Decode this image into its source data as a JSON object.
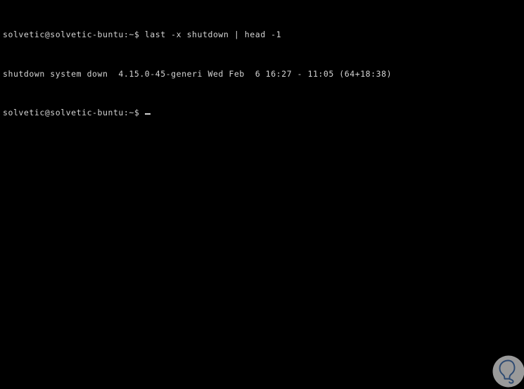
{
  "terminal": {
    "background_color": "#000000",
    "text_color": "#d4d4d4",
    "lines": [
      {
        "kind": "command",
        "prompt": "solvetic@solvetic-buntu:~$ ",
        "text": "last -x shutdown | head -1"
      },
      {
        "kind": "output",
        "text": "shutdown system down  4.15.0-45-generi Wed Feb  6 16:27 - 11:05 (64+18:38)"
      },
      {
        "kind": "prompt",
        "prompt": "solvetic@solvetic-buntu:~$ ",
        "text": ""
      }
    ],
    "cursor": {
      "shape": "underscore",
      "color": "#d4d4d4"
    }
  },
  "watermark": {
    "icon": "lightbulb-icon",
    "circle_color": "#9a9a9a",
    "glyph_color": "#2d4a72"
  }
}
